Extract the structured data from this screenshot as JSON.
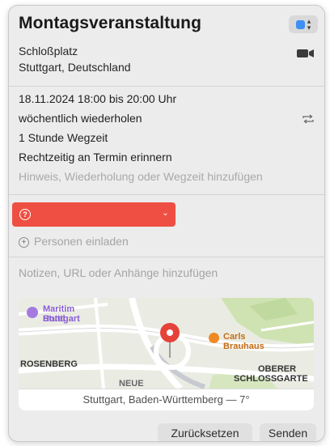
{
  "event": {
    "title": "Montagsveranstaltung",
    "location_line1": "Schloßplatz",
    "location_line2": "Stuttgart, Deutschland",
    "date_time": "18.11.2024  18:00 bis 20:00 Uhr",
    "repeat": "wöchentlich wiederholen",
    "travel_time": "1 Stunde Wegzeit",
    "alert": "Rechtzeitig an Termin erinnern",
    "add_hint": "Hinweis, Wiederholung oder Wegzeit hinzufügen"
  },
  "calendar": {
    "color": "#3f8ff6",
    "selected_name": "",
    "badge_color": "#ef4f42",
    "warning_symbol": "?"
  },
  "invite": {
    "label": "Personen einladen"
  },
  "notes": {
    "placeholder": "Notizen, URL oder Anhänge hinzufügen"
  },
  "map": {
    "poi_hotel": "Maritim Hotel Stuttgart",
    "poi_hotel_line1": "Maritim Hotel",
    "poi_hotel_line2": "Stuttgart",
    "poi_brauhaus": "Carls Brauhaus",
    "district_left": "ROSENBERG",
    "district_right_line1": "OBERER",
    "district_right_line2": "SCHLOSSGARTE",
    "partial_street": "NEUE",
    "caption": "Stuttgart, Baden-Württemberg — 7°"
  },
  "buttons": {
    "reset": "Zurücksetzen",
    "send": "Senden"
  },
  "icons": {
    "video": "video-camera-icon",
    "repeat": "repeat-arrows-icon",
    "warning": "question-circle-icon",
    "invite": "plus-circle-icon",
    "pin": "map-pin-icon"
  }
}
